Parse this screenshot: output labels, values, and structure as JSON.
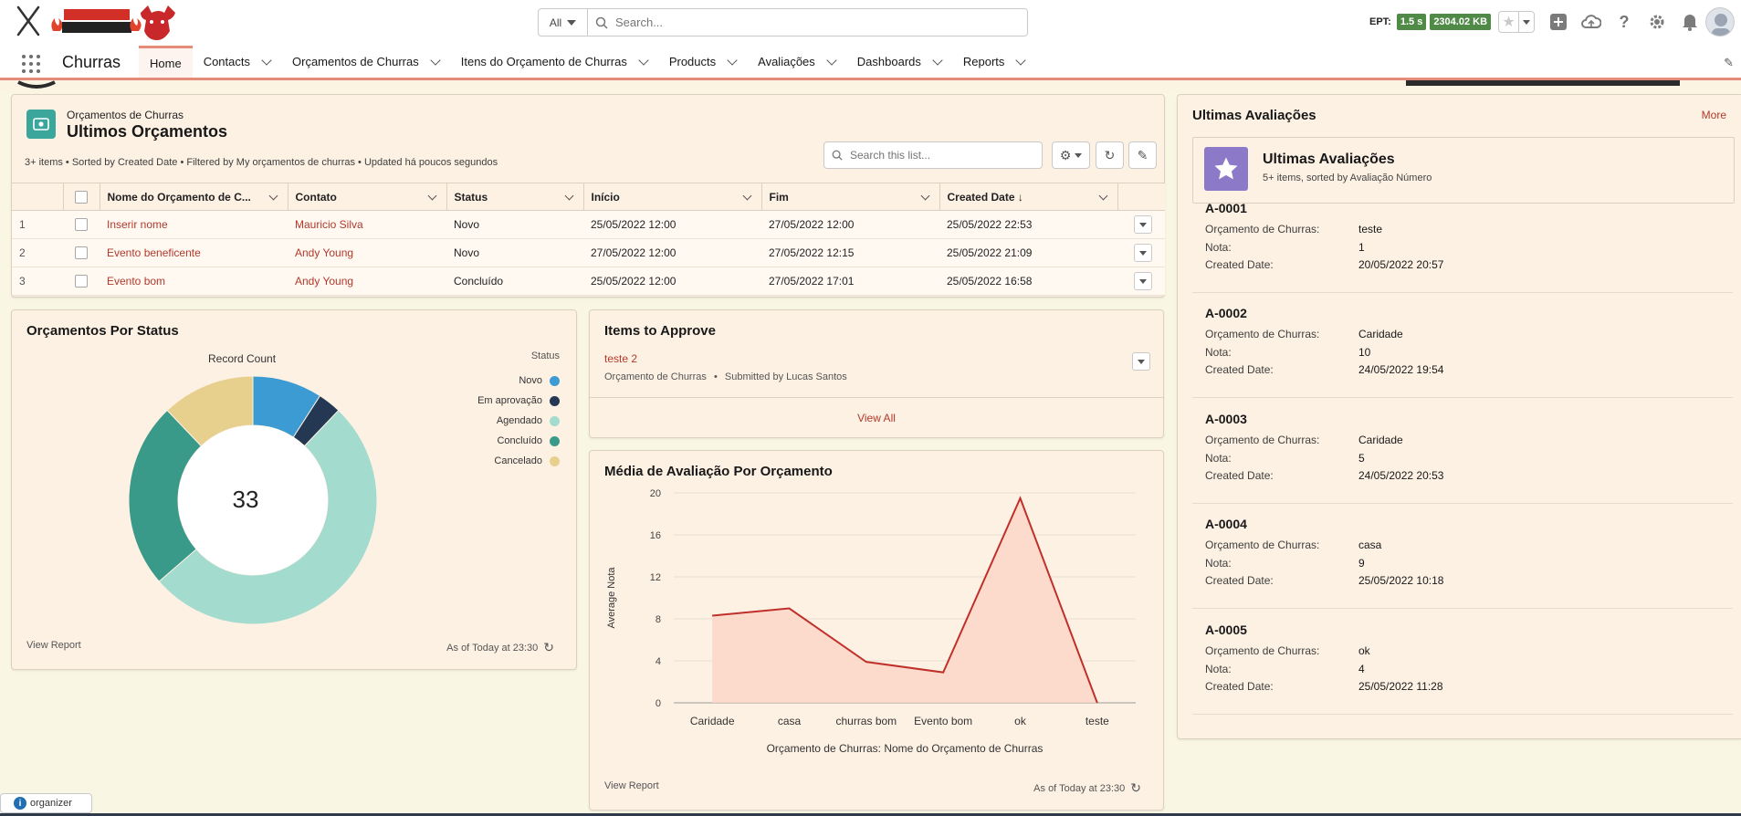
{
  "header": {
    "search_scope": "All",
    "search_placeholder": "Search...",
    "ept_label": "EPT:",
    "ept_time": "1.5 s",
    "ept_size": "2304.02 KB"
  },
  "nav": {
    "app_name": "Churras",
    "items": [
      {
        "label": "Home",
        "active": true,
        "chevron": false
      },
      {
        "label": "Contacts",
        "active": false,
        "chevron": true
      },
      {
        "label": "Orçamentos de Churras",
        "active": false,
        "chevron": true
      },
      {
        "label": "Itens do Orçamento de Churras",
        "active": false,
        "chevron": true
      },
      {
        "label": "Products",
        "active": false,
        "chevron": true
      },
      {
        "label": "Avaliações",
        "active": false,
        "chevron": true
      },
      {
        "label": "Dashboards",
        "active": false,
        "chevron": true
      },
      {
        "label": "Reports",
        "active": false,
        "chevron": true
      }
    ]
  },
  "list_view": {
    "object": "Orçamentos de Churras",
    "title": "Ultimos Orçamentos",
    "meta": "3+ items • Sorted by Created Date • Filtered by My orçamentos de churras • Updated há poucos segundos",
    "search_placeholder": "Search this list...",
    "columns": [
      "Nome do Orçamento de C...",
      "Contato",
      "Status",
      "Início",
      "Fim",
      "Created Date"
    ],
    "rows": [
      {
        "num": "1",
        "nome": "Inserir nome",
        "contato": "Mauricio Silva",
        "status": "Novo",
        "inicio": "25/05/2022 12:00",
        "fim": "27/05/2022 12:00",
        "created": "25/05/2022 22:53"
      },
      {
        "num": "2",
        "nome": "Evento beneficente",
        "contato": "Andy Young",
        "status": "Novo",
        "inicio": "27/05/2022 12:00",
        "fim": "27/05/2022 12:15",
        "created": "25/05/2022 21:09"
      },
      {
        "num": "3",
        "nome": "Evento bom",
        "contato": "Andy Young",
        "status": "Concluído",
        "inicio": "25/05/2022 12:00",
        "fim": "27/05/2022 17:01",
        "created": "25/05/2022 16:58"
      }
    ]
  },
  "donut": {
    "title": "Orçamentos Por Status",
    "center_label": "Record Count",
    "total": "33",
    "legend_title": "Status",
    "view_report": "View Report",
    "as_of": "As of Today at 23:30"
  },
  "approve": {
    "title": "Items to Approve",
    "item_name": "teste 2",
    "item_object": "Orçamento de Churras",
    "item_submitted": "Submitted by Lucas Santos",
    "view_all": "View All"
  },
  "line": {
    "title": "Média de Avaliação Por Orçamento",
    "view_report": "View Report",
    "as_of": "As of Today at 23:30"
  },
  "side": {
    "title": "Ultimas Avaliações",
    "more": "More",
    "list_title": "Ultimas Avaliações",
    "list_meta": "5+ items, sorted by Avaliação Número",
    "label_orc": "Orçamento de Churras:",
    "label_nota": "Nota:",
    "label_date": "Created Date:",
    "items": [
      {
        "id": "A-0001",
        "orc": "teste",
        "nota": "1",
        "date": "20/05/2022 20:57"
      },
      {
        "id": "A-0002",
        "orc": "Caridade",
        "nota": "10",
        "date": "24/05/2022 19:54"
      },
      {
        "id": "A-0003",
        "orc": "Caridade",
        "nota": "5",
        "date": "24/05/2022 20:53"
      },
      {
        "id": "A-0004",
        "orc": "casa",
        "nota": "9",
        "date": "25/05/2022 10:18"
      },
      {
        "id": "A-0005",
        "orc": "ok",
        "nota": "4",
        "date": "25/05/2022 11:28"
      }
    ]
  },
  "footer": {
    "organizer": "organizer"
  },
  "colors": {
    "accent": "#b2392b",
    "nav_accent": "#e58b7a",
    "card_bg": "#fdf1e4",
    "page_bg": "#faf6e4"
  },
  "chart_data": [
    {
      "type": "pie",
      "title": "Orçamentos Por Status",
      "subtitle": "Record Count",
      "legend_title": "Status",
      "total": 33,
      "categories": [
        "Novo",
        "Em aprovação",
        "Agendado",
        "Concluído",
        "Cancelado"
      ],
      "values": [
        3,
        1,
        17,
        8,
        4
      ],
      "colors": [
        "#3b9bd2",
        "#243853",
        "#a3dbce",
        "#3a9a8a",
        "#e7d08e"
      ],
      "legend_position": "right"
    },
    {
      "type": "area",
      "title": "Média de Avaliação Por Orçamento",
      "xlabel": "Orçamento de Churras: Nome do Orçamento de Churras",
      "ylabel": "Average Nota",
      "categories": [
        "Caridade",
        "casa",
        "churras bom",
        "Evento bom",
        "ok",
        "teste"
      ],
      "values": [
        8.3,
        9,
        3.9,
        2.9,
        19.5,
        0
      ],
      "ylim": [
        0,
        20
      ],
      "yticks": [
        "0",
        "4",
        "8",
        "12",
        "16",
        "20"
      ],
      "color": "#c0302b",
      "fill": "#fbd7c8"
    }
  ]
}
